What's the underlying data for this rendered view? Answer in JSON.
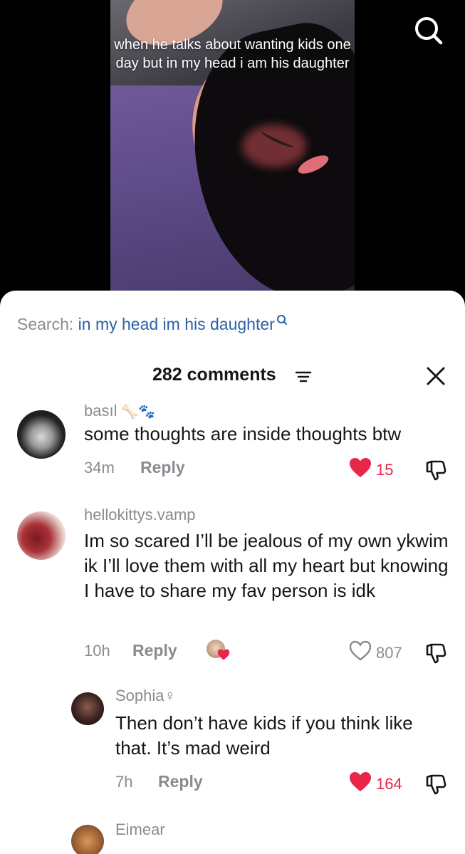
{
  "video": {
    "caption": "when he talks about wanting kids one day but in my head i am his daughter"
  },
  "search": {
    "label": "Search:",
    "query": "in my head im his daughter"
  },
  "header": {
    "comment_count": "282 comments"
  },
  "colors": {
    "liked": "#e8264a",
    "link": "#2b5fa8",
    "muted": "#8a8b91"
  },
  "comments": [
    {
      "username": "basıl",
      "username_emoji": "🦴🐾",
      "text": "some thoughts are inside thoughts btw",
      "time": "34m",
      "reply": "Reply",
      "likes": "15",
      "liked": true
    },
    {
      "username": "hellokittys.vamp",
      "text": "Im so scared I’ll be jealous of my own ykwim ik I’ll love them with all my heart but knowing I have to share my fav person is idk",
      "time": "10h",
      "reply": "Reply",
      "likes": "807",
      "liked": false
    },
    {
      "username": "Sophia♀",
      "text": "Then don’t have kids if you think like that. It’s mad weird",
      "time": "7h",
      "reply": "Reply",
      "likes": "164",
      "liked": true
    },
    {
      "username": "Eimear"
    }
  ]
}
